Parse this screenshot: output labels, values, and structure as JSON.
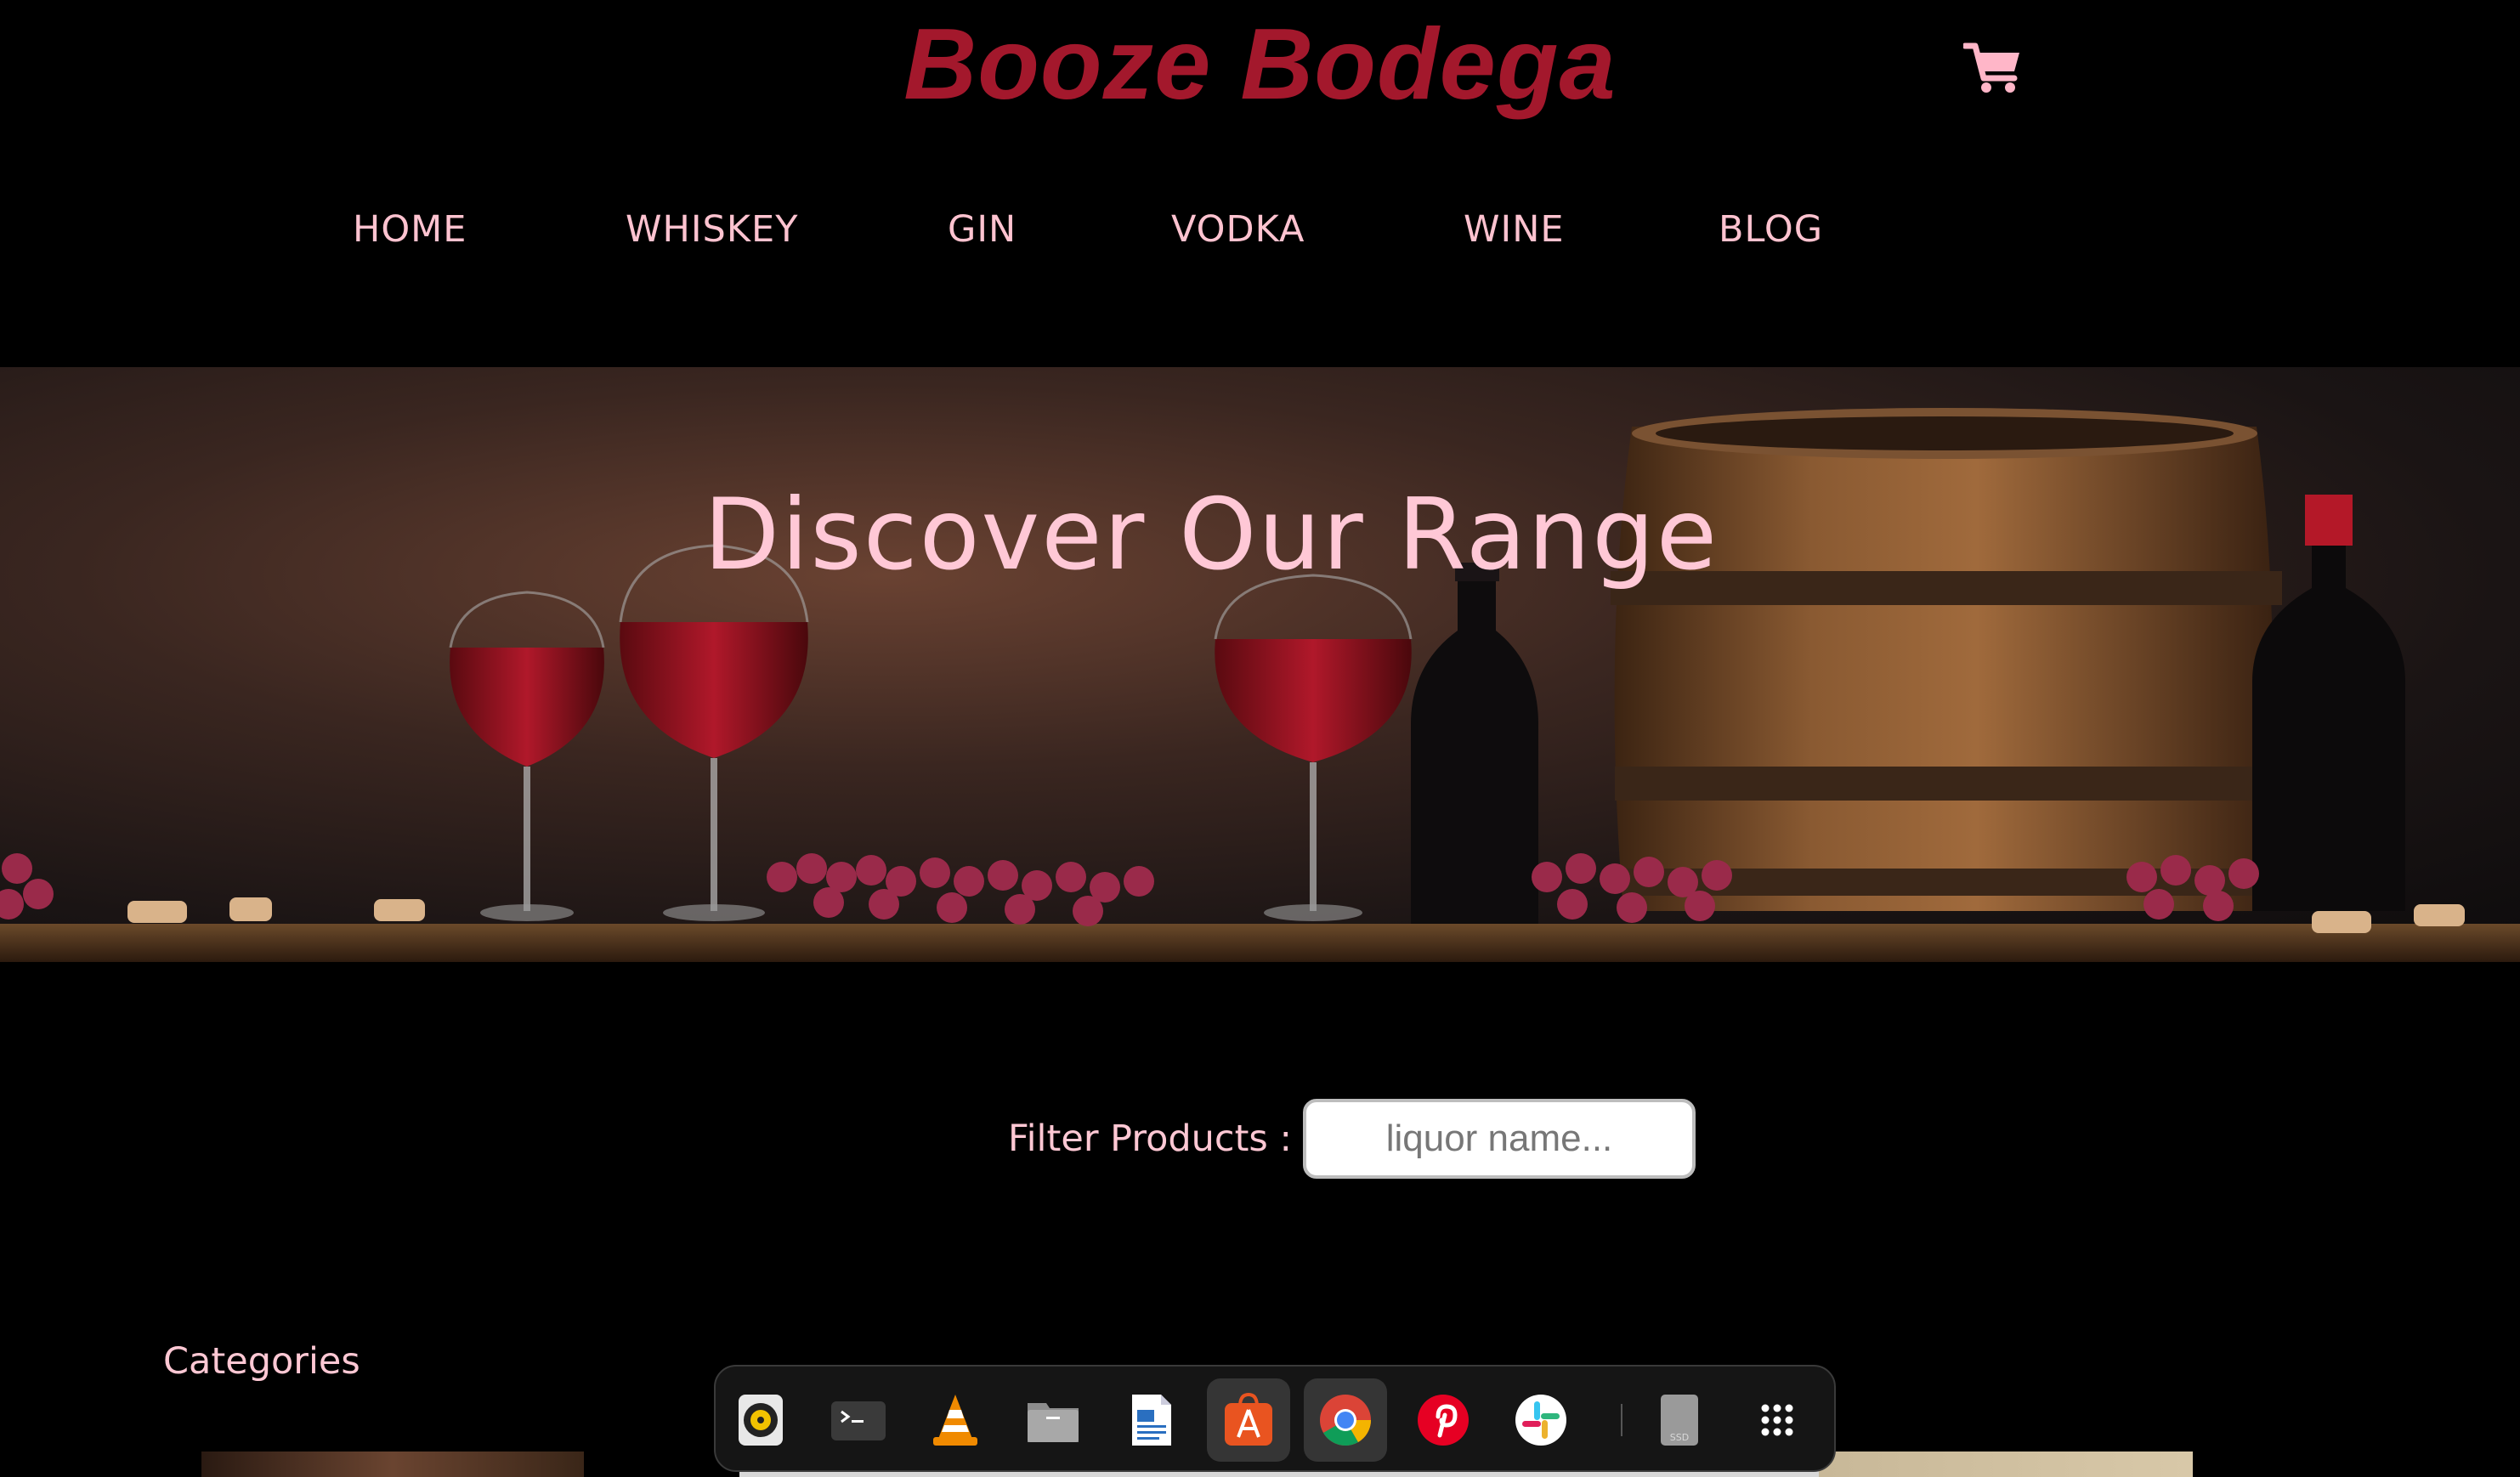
{
  "site": {
    "brand": "Booze Bodega"
  },
  "header": {
    "cart_icon": "shopping-cart-icon",
    "cart_color": "#ffb6c8",
    "brand_color": "#a3182c"
  },
  "nav": {
    "items": [
      {
        "label": "HOME"
      },
      {
        "label": "WHISKEY"
      },
      {
        "label": "GIN"
      },
      {
        "label": "VODKA"
      },
      {
        "label": "WINE"
      },
      {
        "label": "BLOG"
      }
    ]
  },
  "hero": {
    "title": "Discover Our Range",
    "image": "wine-barrel-banner"
  },
  "filter": {
    "label": "Filter Products :",
    "placeholder": "liquor name..."
  },
  "categories": {
    "label": "Categories"
  },
  "dock": {
    "items": [
      {
        "name": "rhythmbox",
        "icon": "music-player-icon"
      },
      {
        "name": "terminal",
        "icon": "terminal-icon"
      },
      {
        "name": "vlc",
        "icon": "vlc-cone-icon"
      },
      {
        "name": "files",
        "icon": "folder-icon"
      },
      {
        "name": "text-editor",
        "icon": "document-icon"
      },
      {
        "name": "app-center",
        "icon": "app-store-icon"
      },
      {
        "name": "chrome",
        "icon": "chrome-icon",
        "active": true
      },
      {
        "name": "pinterest",
        "icon": "pinterest-icon"
      },
      {
        "name": "slack",
        "icon": "slack-icon"
      },
      {
        "name": "drive",
        "icon": "drive-icon",
        "label": "SSD"
      },
      {
        "name": "show-apps",
        "icon": "app-grid-icon"
      }
    ]
  }
}
